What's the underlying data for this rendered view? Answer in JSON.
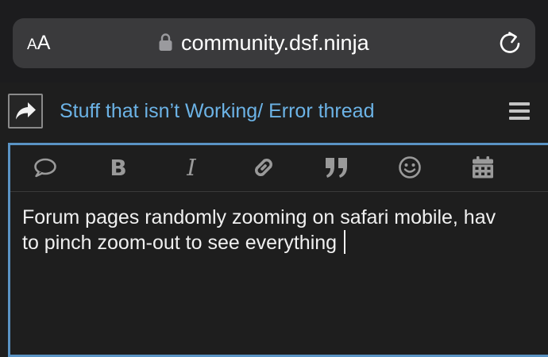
{
  "browser": {
    "text_size_button": {
      "small": "A",
      "large": "A"
    },
    "url": "community.dsf.ninja",
    "lock_icon": "lock-icon",
    "reload_icon": "reload-icon"
  },
  "composer": {
    "action_icon": "reply-icon",
    "topic_title": "Stuff that isn’t Working/ Error thread",
    "menu_icon": "hamburger-menu-icon",
    "accent_color": "#6cb3e6",
    "border_color": "#5a93c4",
    "toolbar": [
      {
        "name": "blockquote-icon"
      },
      {
        "name": "bold-icon",
        "glyph": "B"
      },
      {
        "name": "italic-icon",
        "glyph": "I"
      },
      {
        "name": "link-icon"
      },
      {
        "name": "quote-icon"
      },
      {
        "name": "emoji-icon"
      },
      {
        "name": "calendar-icon"
      }
    ],
    "body_lines": [
      "Forum pages randomly zooming on safari mobile, hav",
      "to pinch zoom-out to see everything"
    ]
  }
}
